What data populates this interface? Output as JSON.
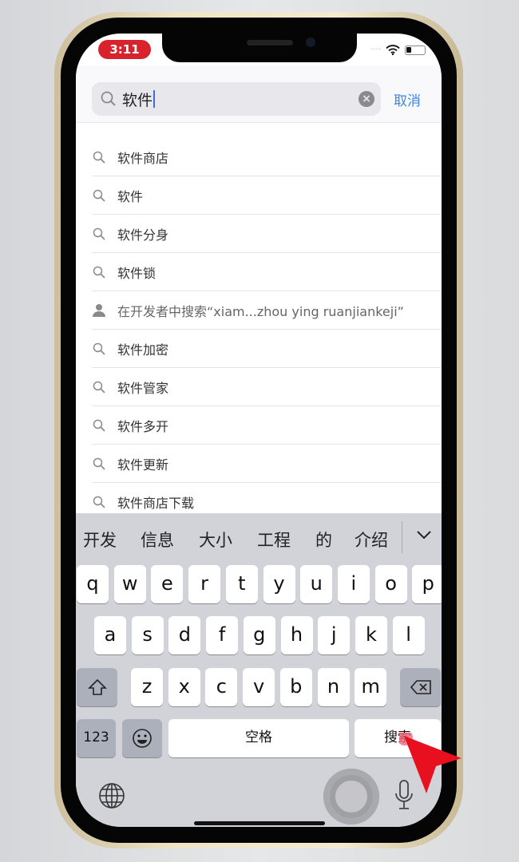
{
  "status": {
    "time": "3:11",
    "wifi_icon": "wifi-icon",
    "battery_icon": "battery-icon"
  },
  "search": {
    "value": "软件",
    "cancel_label": "取消"
  },
  "suggestions": [
    {
      "icon": "search-icon",
      "label": "软件商店"
    },
    {
      "icon": "search-icon",
      "label": "软件"
    },
    {
      "icon": "search-icon",
      "label": "软件分身"
    },
    {
      "icon": "search-icon",
      "label": "软件锁"
    },
    {
      "icon": "person-icon",
      "label": "在开发者中搜索“xiam...zhou ying ruanjiankeji”"
    },
    {
      "icon": "search-icon",
      "label": "软件加密"
    },
    {
      "icon": "search-icon",
      "label": "软件管家"
    },
    {
      "icon": "search-icon",
      "label": "软件多开"
    },
    {
      "icon": "search-icon",
      "label": "软件更新"
    },
    {
      "icon": "search-icon",
      "label": "软件商店下载"
    }
  ],
  "keyboard": {
    "candidates": [
      "开发",
      "信息",
      "大小",
      "工程",
      "的",
      "介绍"
    ],
    "row1": [
      "q",
      "w",
      "e",
      "r",
      "t",
      "y",
      "u",
      "i",
      "o",
      "p"
    ],
    "row2": [
      "a",
      "s",
      "d",
      "f",
      "g",
      "h",
      "j",
      "k",
      "l"
    ],
    "row3": [
      "z",
      "x",
      "c",
      "v",
      "b",
      "n",
      "m"
    ],
    "numbers_label": "123",
    "space_label": "空格",
    "search_label": "搜索"
  },
  "colors": {
    "accent": "#3b86e6",
    "time_pill": "#d9232c",
    "pointer": "#e8101e"
  }
}
